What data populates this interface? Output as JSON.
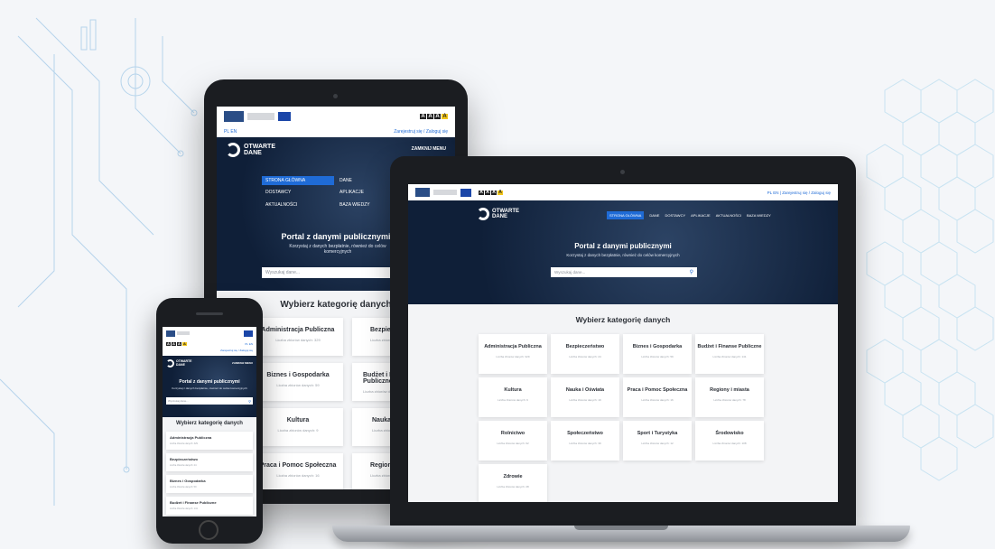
{
  "logos": {
    "fe": "Fundusze Europejskie",
    "eu": "Unia Europejska"
  },
  "aaa": [
    "A",
    "A",
    "A",
    "A"
  ],
  "lang": {
    "pl": "PL",
    "en": "EN"
  },
  "auth": "Zarejestruj się / Zaloguj się",
  "brand": {
    "l1": "OTWARTE",
    "l2": "DANE"
  },
  "menu_close": "ZAMKNIJ MENU",
  "nav": [
    "STRONA GŁÓWNA",
    "DANE",
    "DOSTAWCY",
    "APLIKACJE",
    "AKTUALNOŚCI",
    "BAZA WIEDZY"
  ],
  "hero": {
    "title": "Portal z danymi publicznymi",
    "subtitle": "Korzystaj z danych bezpłatnie, również do celów komercyjnych"
  },
  "search": {
    "placeholder": "Wyszukaj dane..."
  },
  "categories_title": "Wybierz kategorię danych",
  "categories": [
    {
      "name": "Administracja Publiczna",
      "count": "Liczba zbiorów danych: 329"
    },
    {
      "name": "Bezpieczeństwo",
      "count": "Liczba zbiorów danych: 24"
    },
    {
      "name": "Biznes i Gospodarka",
      "count": "Liczba zbiorów danych: 59"
    },
    {
      "name": "Budżet i Finanse Publiczne",
      "count": "Liczba zbiorów danych: 141"
    },
    {
      "name": "Kultura",
      "count": "Liczba zbiorów danych: 9"
    },
    {
      "name": "Nauka i Oświata",
      "count": "Liczba zbiorów danych: 19"
    },
    {
      "name": "Praca i Pomoc Społeczna",
      "count": "Liczba zbiorów danych: 16"
    },
    {
      "name": "Regiony i miasta",
      "count": "Liczba zbiorów danych: 78"
    },
    {
      "name": "Rolnictwo",
      "count": "Liczba zbiorów danych: 62"
    },
    {
      "name": "Społeczeństwo",
      "count": "Liczba zbiorów danych: 39"
    },
    {
      "name": "Sport i Turystyka",
      "count": "Liczba zbiorów danych: 12"
    },
    {
      "name": "Środowisko",
      "count": "Liczba zbiorów danych: 108"
    },
    {
      "name": "Zdrowie",
      "count": "Liczba zbiorów danych: 28"
    }
  ],
  "colors": {
    "accent": "#1f6bd6",
    "hero_dark": "#0f1f38"
  }
}
